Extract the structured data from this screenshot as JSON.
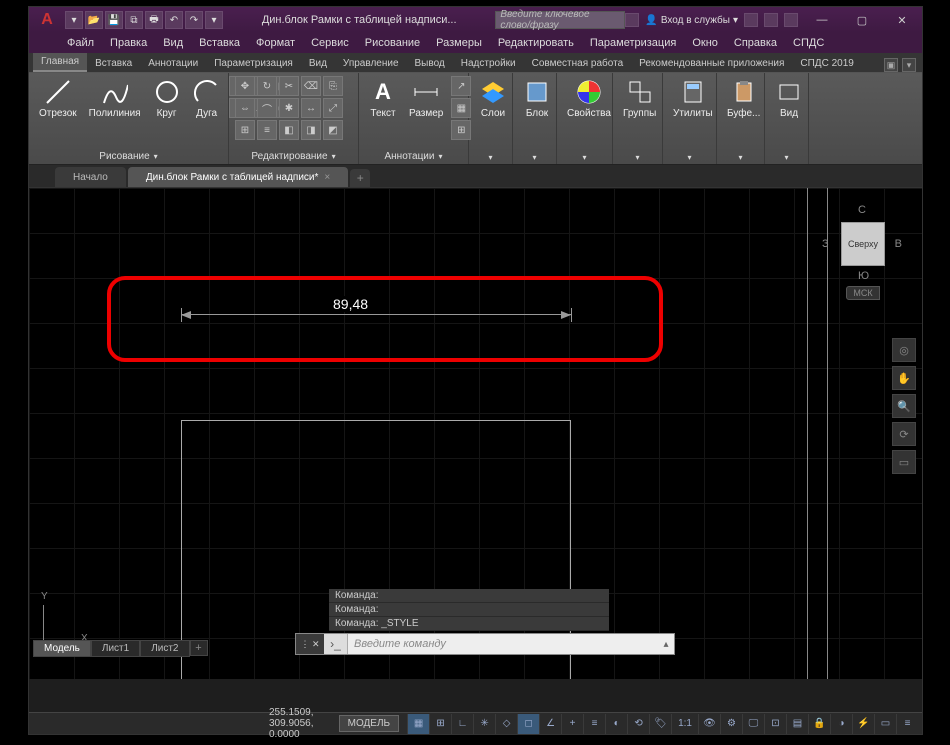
{
  "title": "Дин.блок Рамки с таблицей надписи...",
  "search_placeholder": "Введите ключевое слово/фразу",
  "signin_label": "Вход в службы",
  "menubar": [
    "Файл",
    "Правка",
    "Вид",
    "Вставка",
    "Формат",
    "Сервис",
    "Рисование",
    "Размеры",
    "Редактировать",
    "Параметризация",
    "Окно",
    "Справка",
    "СПДС"
  ],
  "ribbon_tabs": [
    "Главная",
    "Вставка",
    "Аннотации",
    "Параметризация",
    "Вид",
    "Управление",
    "Вывод",
    "Надстройки",
    "Совместная работа",
    "Рекомендованные приложения",
    "СПДС 2019"
  ],
  "ribbon_active": 0,
  "panels": {
    "draw": {
      "label": "Рисование",
      "items": [
        "Отрезок",
        "Полилиния",
        "Круг",
        "Дуга"
      ]
    },
    "modify": {
      "label": "Редактирование"
    },
    "annot": {
      "label": "Аннотации",
      "items": [
        "Текст",
        "Размер"
      ]
    },
    "layers": {
      "label": "Слои"
    },
    "block": {
      "label": "Блок"
    },
    "props": {
      "label": "Свойства"
    },
    "groups": {
      "label": "Группы"
    },
    "utils": {
      "label": "Утилиты"
    },
    "clip": {
      "label": "Буфе..."
    },
    "view": {
      "label": "Вид"
    }
  },
  "doc_tabs": {
    "start": "Начало",
    "active": "Дин.блок Рамки с таблицей надписи*"
  },
  "dimension_value": "89,48",
  "ucs": {
    "x": "X",
    "y": "Y"
  },
  "viewcube": {
    "top": "Сверху",
    "n": "С",
    "s": "Ю",
    "e": "В",
    "w": "З",
    "wcs": "МСК"
  },
  "cmd_history": [
    "Команда:",
    "Команда:",
    "Команда: _STYLE"
  ],
  "cmd_placeholder": "Введите команду",
  "layout_tabs": [
    "Модель",
    "Лист1",
    "Лист2"
  ],
  "status": {
    "coords": "255.1509, 309.9056, 0.0000",
    "model": "МОДЕЛЬ",
    "scale": "1:1"
  }
}
